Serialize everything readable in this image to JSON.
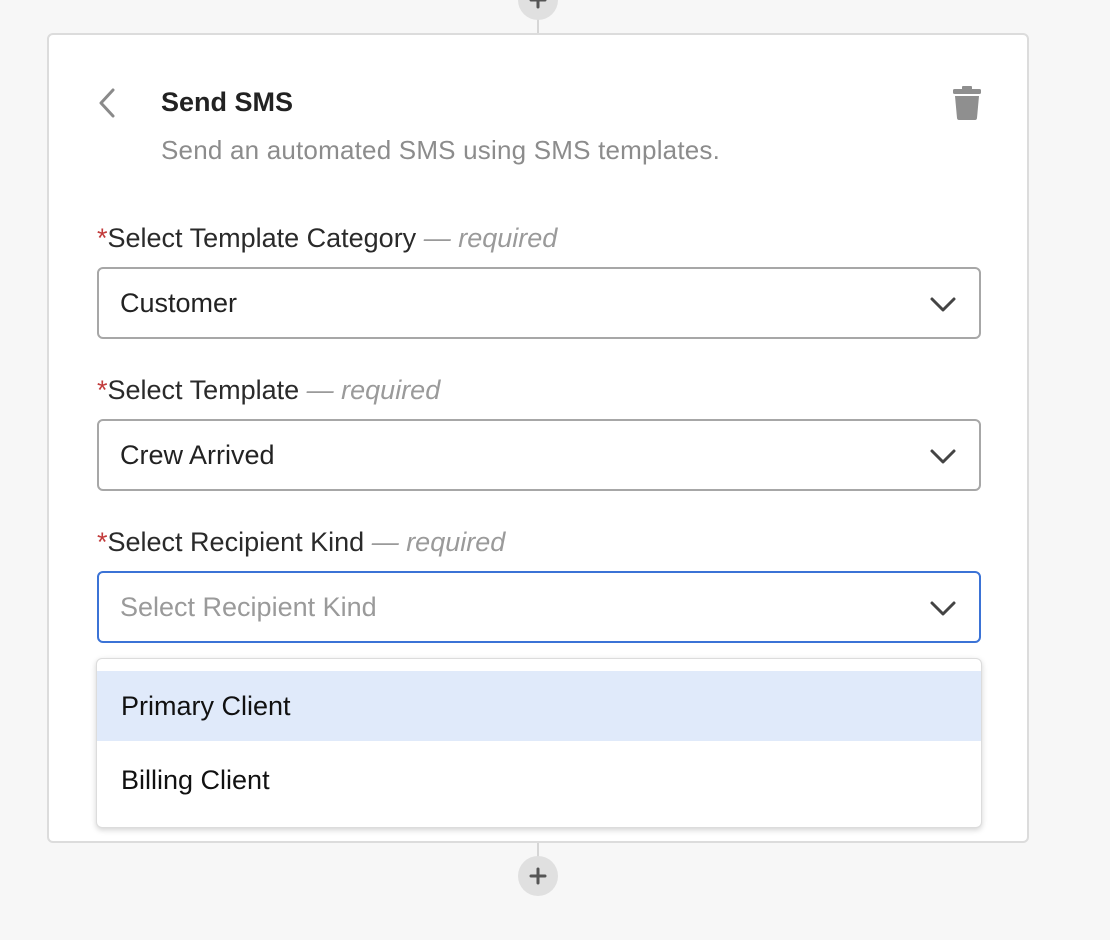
{
  "step": {
    "title": "Send SMS",
    "description": "Send an automated SMS using SMS templates."
  },
  "fields": [
    {
      "asterisk": "*",
      "label": "Select Template Category",
      "required_hint": "— required",
      "value": "Customer",
      "placeholder": ""
    },
    {
      "asterisk": "*",
      "label": "Select Template",
      "required_hint": "— required",
      "value": "Crew Arrived",
      "placeholder": ""
    },
    {
      "asterisk": "*",
      "label": "Select Recipient Kind",
      "required_hint": "— required",
      "value": "",
      "placeholder": "Select Recipient Kind"
    }
  ],
  "dropdown": {
    "options": [
      "Primary Client",
      "Billing Client"
    ],
    "highlighted_index": 0
  },
  "icons": {
    "back": "chevron-left-icon",
    "delete": "trash-icon",
    "add": "plus-icon",
    "expand": "chevron-down-icon"
  },
  "colors": {
    "required_asterisk": "#c23b3b",
    "focus_border": "#3b73d6",
    "highlight_bg": "#e0eafa"
  }
}
